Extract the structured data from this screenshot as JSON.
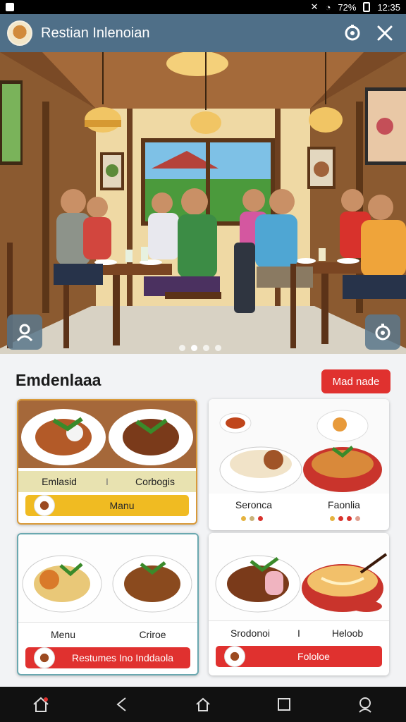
{
  "status_bar": {
    "time": "12:35",
    "battery": "72%"
  },
  "header": {
    "title": "Restian Inlenoian",
    "settings_icon": "settings-icon",
    "close_icon": "close-icon"
  },
  "hero": {
    "dots_count": 4,
    "active_dot": 2
  },
  "section": {
    "title": "Emdenlaaa",
    "action_button": "Mad nade",
    "cards": [
      {
        "left_label": "Emlasid",
        "divider": "I",
        "right_label": "Corbogis",
        "bar_label": "Manu"
      },
      {
        "left_label": "Seronca",
        "right_label": "Faonlia"
      },
      {
        "left_label": "Menu",
        "right_label": "Criroe",
        "bar_label": "Restumes Ino Inddaola"
      },
      {
        "left_label": "Srodonoi",
        "divider": "I",
        "right_label": "Heloob",
        "bar_label": "Fololoe"
      }
    ]
  },
  "colors": {
    "app_bar": "#4f6f88",
    "accent_red": "#e0312f",
    "accent_yellow": "#f0bb22",
    "card_bg": "#ffffff"
  }
}
